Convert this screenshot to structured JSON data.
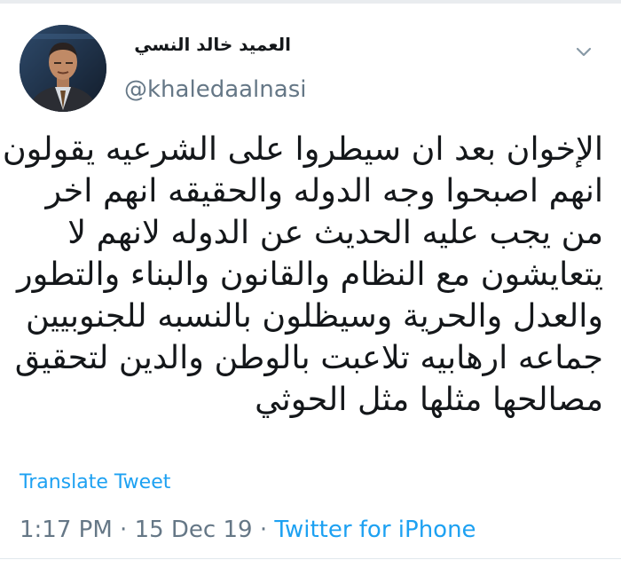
{
  "tweet": {
    "author": {
      "display_name": "العميد خالد النسي",
      "handle": "@khaledaalnasi"
    },
    "text_lines": [
      "الإخوان بعد ان سيطروا على الشرعيه يقولون",
      "انهم اصبحوا وجه الدوله والحقيقه انهم اخر",
      "من يجب عليه الحديث عن الدوله لانهم لا",
      "يتعايشون مع النظام والقانون والبناء والتطور",
      "والعدل والحرية وسيظلون بالنسبه للجنوبيين",
      "جماعه ارهابيه تلاعبت بالوطن والدين لتحقيق",
      "مصالحها مثلها مثل الحوثي"
    ],
    "translate_label": "Translate Tweet",
    "time": "1:17 PM",
    "date": "15 Dec 19",
    "separator": " · ",
    "source": "Twitter for iPhone"
  },
  "icons": {
    "menu": "chevron-down-icon"
  },
  "colors": {
    "link": "#1da1f2",
    "secondary_text": "#657786",
    "primary_text": "#14171a"
  }
}
